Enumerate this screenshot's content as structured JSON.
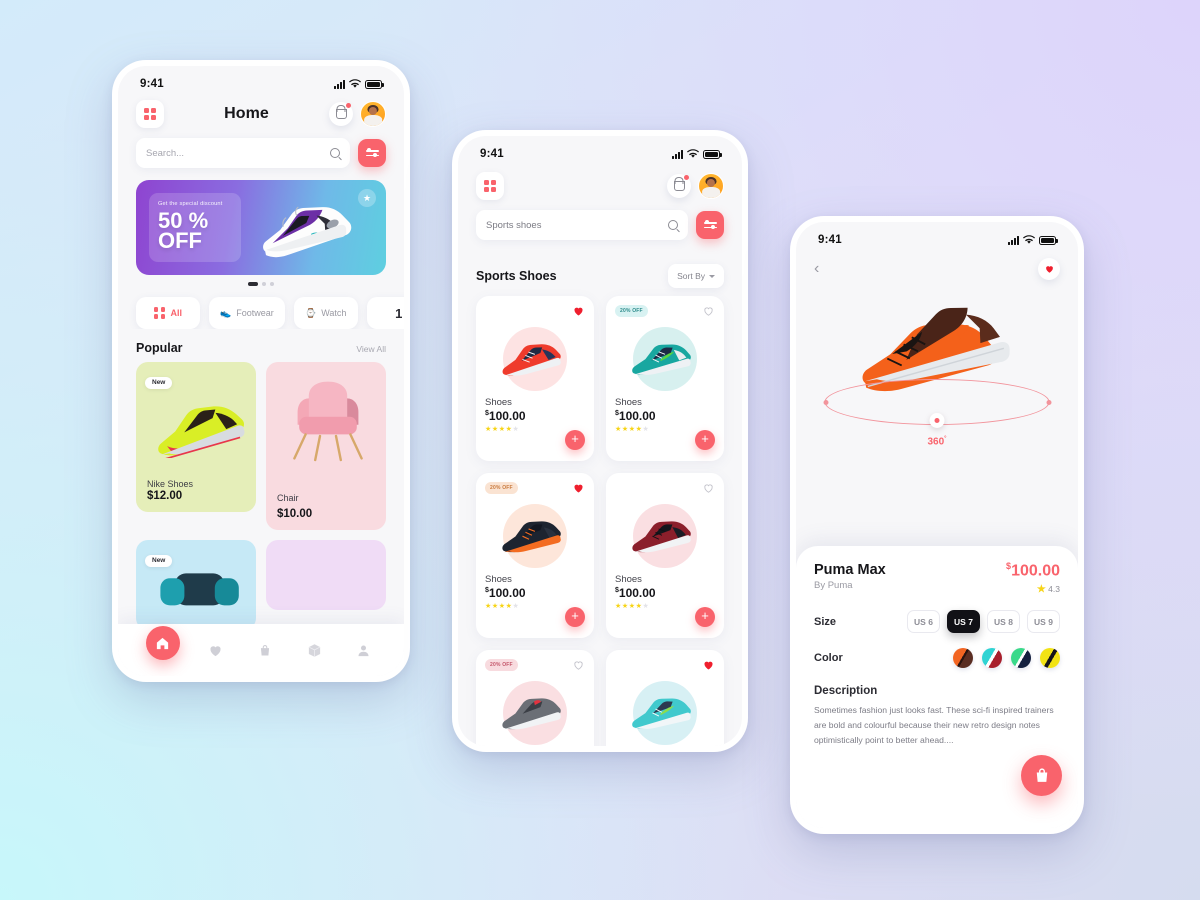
{
  "theme": {
    "accent": "#f9636c",
    "dark": "#111116",
    "bg_gradient_from": "#d3ebfa",
    "bg_gradient_to": "#e3dcf8"
  },
  "phone1": {
    "status": {
      "time": "9:41"
    },
    "header": {
      "title": "Home",
      "menu_icon": "grid-icon",
      "cart_icon": "shopping-basket-icon",
      "avatar_icon": "user-avatar"
    },
    "search": {
      "placeholder": "Search...",
      "value": "",
      "search_icon": "magnifier-icon",
      "filter_icon": "filter-sliders-icon"
    },
    "promo": {
      "subtitle": "Get the special discount",
      "headline_line1": "50 %",
      "headline_line2": "OFF",
      "star_icon": "star-icon",
      "dots": 3,
      "active_dot": 0
    },
    "categories": [
      {
        "label": "All",
        "icon": "grid-icon",
        "active": true
      },
      {
        "label": "Footwear",
        "icon": "sneaker-icon",
        "active": false
      },
      {
        "label": "Watch",
        "icon": "watch-icon",
        "active": false
      },
      {
        "label": "1",
        "icon": "cut-off",
        "active": false
      }
    ],
    "section": {
      "title": "Popular",
      "link": "View All"
    },
    "popular": [
      {
        "name": "Nike Shoes",
        "price": "$12.00",
        "badge": "New",
        "bg": "#e5eeb9",
        "image": "green-sneaker"
      },
      {
        "name": "Chair",
        "price": "$10.00",
        "badge": "",
        "bg": "#f9dbe0",
        "image": "pink-chair"
      },
      {
        "name": "",
        "price": "",
        "badge": "New",
        "bg": "#c6e9f6",
        "image": "blue-headphones"
      },
      {
        "name": "",
        "price": "",
        "badge": "",
        "bg": "#f0dcf6",
        "image": "purple-item"
      }
    ],
    "tabs": [
      {
        "name": "home",
        "icon": "home-icon",
        "active": true
      },
      {
        "name": "favorites",
        "icon": "heart-icon",
        "active": false
      },
      {
        "name": "bag",
        "icon": "shopping-bag-icon",
        "active": false
      },
      {
        "name": "orders",
        "icon": "box-icon",
        "active": false
      },
      {
        "name": "profile",
        "icon": "person-icon",
        "active": false
      }
    ]
  },
  "phone2": {
    "status": {
      "time": "9:41"
    },
    "header": {
      "menu_icon": "grid-icon",
      "cart_icon": "shopping-basket-icon",
      "avatar_icon": "user-avatar"
    },
    "search": {
      "value": "Sports shoes",
      "placeholder": "Search...",
      "search_icon": "magnifier-icon",
      "filter_icon": "filter-sliders-icon"
    },
    "section": {
      "title": "Sports Shoes",
      "sort_label": "Sort By"
    },
    "products": [
      {
        "name": "Shoes",
        "currency": "$",
        "price": "100.00",
        "rating": 4,
        "badge": "",
        "liked": true,
        "halo": "#fde3e3",
        "image": "red-running-shoe"
      },
      {
        "name": "Shoes",
        "currency": "$",
        "price": "100.00",
        "rating": 4,
        "badge": "20% OFF",
        "badge_style": "teal",
        "liked": false,
        "halo": "#d7f0ef",
        "image": "teal-nike-shoe"
      },
      {
        "name": "Shoes",
        "currency": "$",
        "price": "100.00",
        "rating": 4,
        "badge": "20% OFF",
        "badge_style": "peach",
        "liked": true,
        "halo": "#fde6da",
        "image": "black-orange-shoe"
      },
      {
        "name": "Shoes",
        "currency": "$",
        "price": "100.00",
        "rating": 4,
        "badge": "",
        "liked": false,
        "halo": "#fadfe2",
        "image": "maroon-knit-shoe"
      },
      {
        "name": "",
        "currency": "",
        "price": "",
        "rating": 0,
        "badge": "20% OFF",
        "badge_style": "pink",
        "liked": false,
        "halo": "#fadfe2",
        "image": "grey-red-shoe"
      },
      {
        "name": "",
        "currency": "",
        "price": "",
        "rating": 0,
        "badge": "",
        "liked": true,
        "halo": "#d7f0f4",
        "image": "mint-nike-shoe"
      }
    ],
    "add_button_label": "+"
  },
  "phone3": {
    "status": {
      "time": "9:41"
    },
    "header": {
      "back_icon": "chevron-left-icon",
      "favorite_icon": "heart-filled-icon"
    },
    "hero": {
      "image": "orange-puma-sneaker",
      "rotate_label": "360",
      "rotate_degree_symbol": "°",
      "rotate_icon": "rotate-360-icon"
    },
    "product": {
      "name": "Puma Max",
      "brand": "By Puma",
      "currency": "$",
      "price": "100.00",
      "rating": "4.3",
      "star_icon": "star-icon"
    },
    "size": {
      "label": "Size",
      "options": [
        {
          "label": "US 6",
          "selected": false
        },
        {
          "label": "US 7",
          "selected": true
        },
        {
          "label": "US 8",
          "selected": false
        },
        {
          "label": "US 9",
          "selected": false
        }
      ]
    },
    "color": {
      "label": "Color",
      "options": [
        {
          "name": "orange-brown",
          "c1": "#f26522",
          "c2": "#5a2d22",
          "selected": true
        },
        {
          "name": "teal-red",
          "c1": "#2fd3d3",
          "c2": "#a81f2c"
        },
        {
          "name": "green-navy",
          "c1": "#3ad98a",
          "c2": "#14203f"
        },
        {
          "name": "yellow-black",
          "c1": "#f2e314",
          "c2": "#15151a"
        }
      ]
    },
    "description": {
      "title": "Description",
      "text": "Sometimes fashion just looks fast. These sci-fi inspired trainers are bold and colourful because  their new retro design notes optimistically point to better ahead...."
    },
    "cart_fab": {
      "icon": "shopping-bag-icon"
    }
  }
}
